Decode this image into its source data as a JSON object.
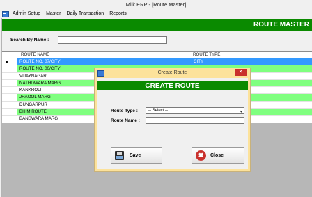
{
  "window": {
    "title": "Milk ERP - [Route Master]"
  },
  "menu": {
    "items": [
      {
        "label": "Admin Setup"
      },
      {
        "label": "Master"
      },
      {
        "label": "Daily Transaction"
      },
      {
        "label": "Reports"
      }
    ]
  },
  "main": {
    "header_title": "ROUTE MASTER",
    "search_label": "Search By Name :",
    "search_value": ""
  },
  "grid": {
    "columns": [
      "ROUTE NAME",
      "ROUTE TYPE"
    ],
    "rows": [
      {
        "name": "ROUTE NO. 07/CITY",
        "type": "CITY"
      },
      {
        "name": "ROUTE NO. 00/CITY",
        "type": ""
      },
      {
        "name": "VIJAYNAGAR",
        "type": ""
      },
      {
        "name": "NATHDWARA MARG",
        "type": ""
      },
      {
        "name": "KANKROLI",
        "type": ""
      },
      {
        "name": "JHAOOL MARG",
        "type": ""
      },
      {
        "name": "DUNGARPUR",
        "type": ""
      },
      {
        "name": "BHIM ROUTE",
        "type": ""
      },
      {
        "name": "BANSWARA MARG",
        "type": ""
      }
    ]
  },
  "dialog": {
    "title": "Create Route",
    "close_glyph": "×",
    "header_title": "CREATE ROUTE",
    "route_type_label": "Route Type :",
    "route_type_selected": "-- Select --",
    "route_name_label": "Route Name :",
    "route_name_value": "",
    "save_label": "Save",
    "close_label": "Close"
  },
  "colors": {
    "header_green": "#0a8a00",
    "row_green": "#7fff7f",
    "row_selected": "#3399ff",
    "dialog_border": "#fce29b",
    "close_red": "#c9302c"
  }
}
